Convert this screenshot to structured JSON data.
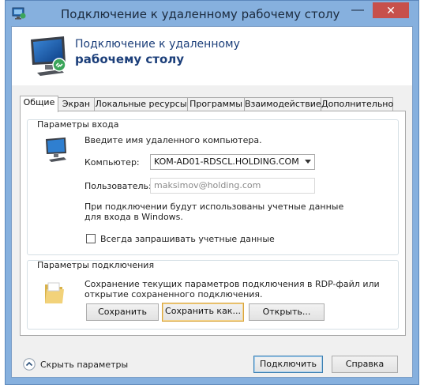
{
  "window": {
    "title": "Подключение к удаленному рабочему столу",
    "minimize_glyph": "—",
    "close_glyph": "✕"
  },
  "header": {
    "line1": "Подключение к удаленному",
    "line2": "рабочему столу"
  },
  "tabs": [
    {
      "label": "Общие",
      "active": true
    },
    {
      "label": "Экран"
    },
    {
      "label": "Локальные ресурсы"
    },
    {
      "label": "Программы"
    },
    {
      "label": "Взаимодействие"
    },
    {
      "label": "Дополнительно"
    }
  ],
  "login_group": {
    "title": "Параметры входа",
    "prompt": "Введите имя удаленного компьютера.",
    "computer_label": "Компьютер:",
    "computer_value": "KOM-AD01-RDSCL.HOLDING.COM",
    "user_label": "Пользователь:",
    "user_value": "maksimov@holding.com",
    "info_line1": "При подключении будут использованы учетные данные",
    "info_line2": "для входа в Windows.",
    "always_ask_label": "Всегда запрашивать учетные данные",
    "always_ask_checked": false
  },
  "connection_group": {
    "title": "Параметры подключения",
    "desc_line1": "Сохранение текущих параметров подключения в RDP-файл или",
    "desc_line2": "открытие сохраненного подключения.",
    "save_label": "Сохранить",
    "save_as_label": "Сохранить как...",
    "open_label": "Открыть..."
  },
  "footer": {
    "hide_params_label": "Скрыть параметры",
    "connect_label": "Подключить",
    "help_label": "Справка"
  },
  "colors": {
    "frame": "#86b0de",
    "close": "#c7504b",
    "header_text": "#1c3f7a"
  }
}
